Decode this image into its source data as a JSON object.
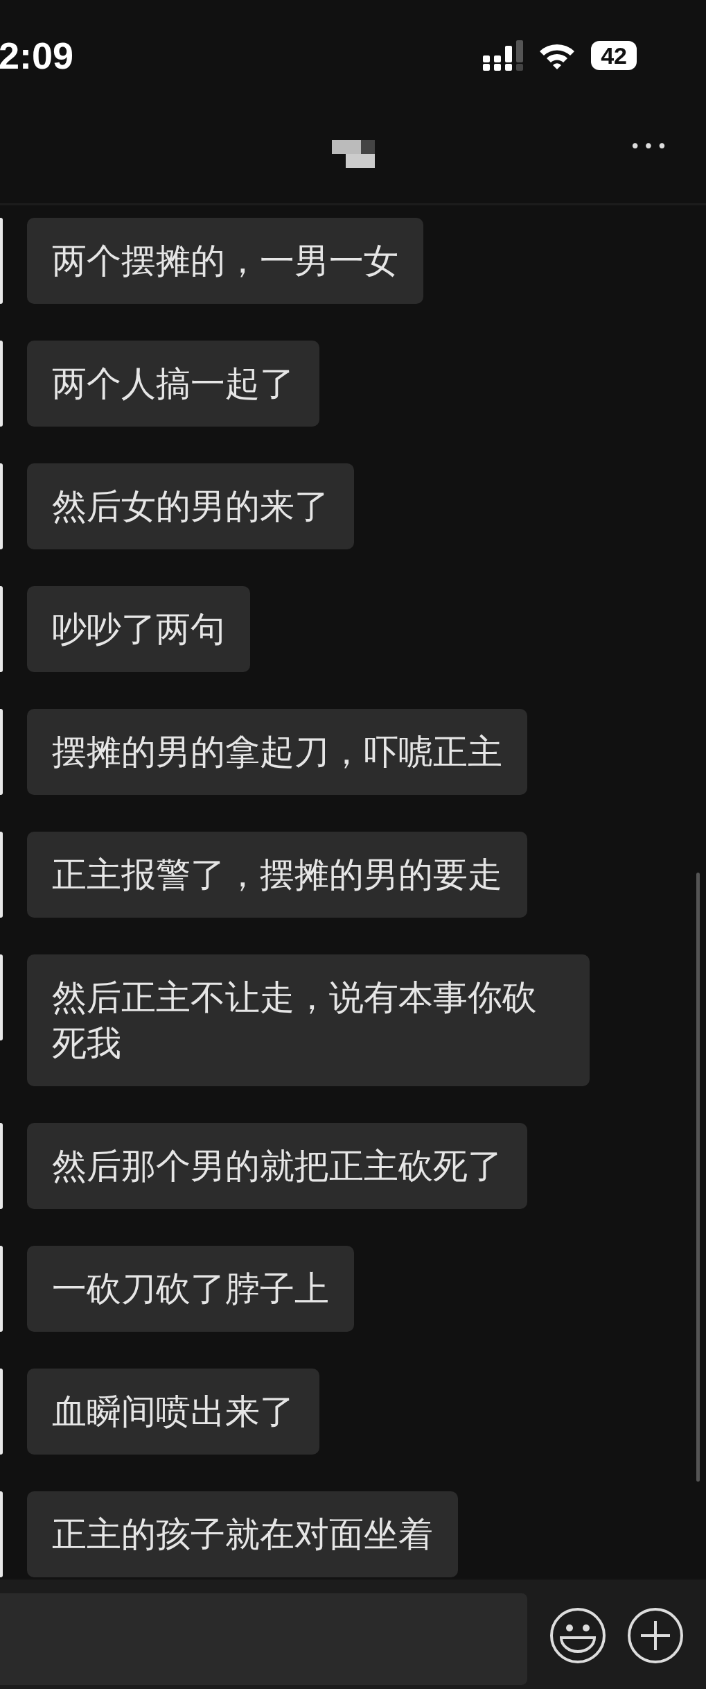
{
  "status_bar": {
    "time": "2:09",
    "battery": "42"
  },
  "header": {
    "more": "•••"
  },
  "messages": [
    {
      "text": "两个摆摊的，一男一女"
    },
    {
      "text": "两个人搞一起了"
    },
    {
      "text": "然后女的男的来了"
    },
    {
      "text": "吵吵了两句"
    },
    {
      "text": "摆摊的男的拿起刀，吓唬正主"
    },
    {
      "text": "正主报警了，摆摊的男的要走"
    },
    {
      "text": "然后正主不让走，说有本事你砍死我"
    },
    {
      "text": "然后那个男的就把正主砍死了"
    },
    {
      "text": "一砍刀砍了脖子上"
    },
    {
      "text": "血瞬间喷出来了"
    },
    {
      "text": "正主的孩子就在对面坐着"
    }
  ]
}
